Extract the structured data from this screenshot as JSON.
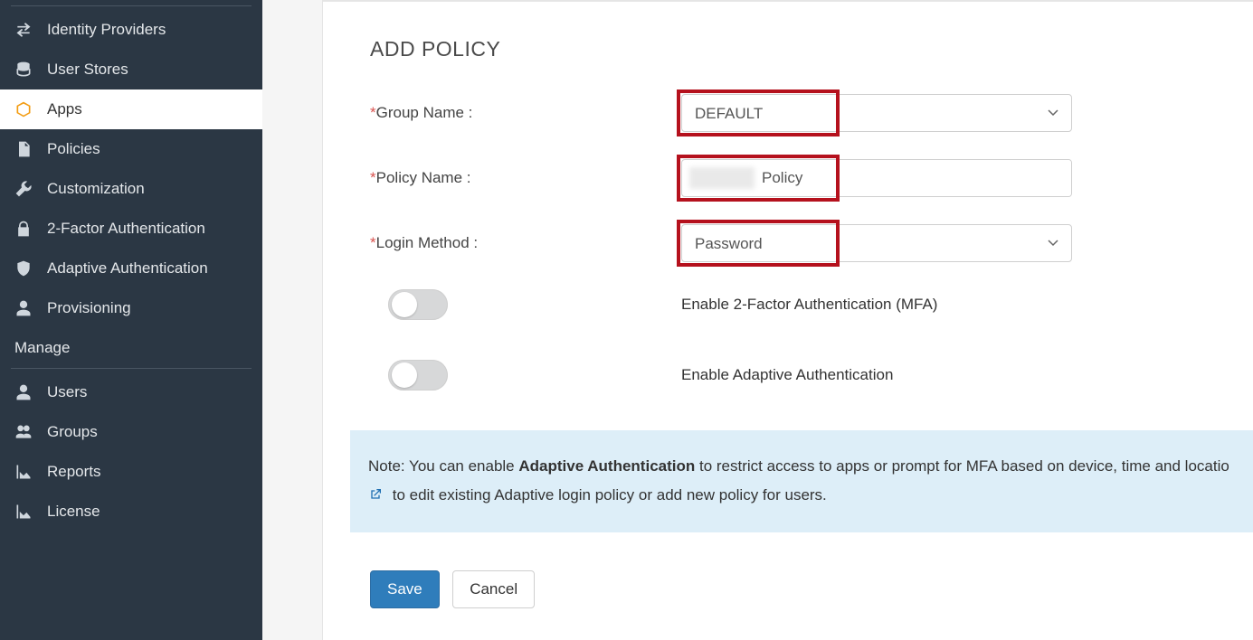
{
  "sidebar": {
    "items": [
      {
        "label": "Identity Providers",
        "icon": "swap-icon"
      },
      {
        "label": "User Stores",
        "icon": "database-icon"
      },
      {
        "label": "Apps",
        "icon": "cube-icon",
        "active": true
      },
      {
        "label": "Policies",
        "icon": "document-icon"
      },
      {
        "label": "Customization",
        "icon": "wrench-icon"
      },
      {
        "label": "2-Factor Authentication",
        "icon": "lock-icon"
      },
      {
        "label": "Adaptive Authentication",
        "icon": "shield-icon"
      },
      {
        "label": "Provisioning",
        "icon": "user-icon"
      }
    ],
    "manage_label": "Manage",
    "manage_items": [
      {
        "label": "Users",
        "icon": "user-icon"
      },
      {
        "label": "Groups",
        "icon": "users-icon"
      },
      {
        "label": "Reports",
        "icon": "area-chart-icon"
      },
      {
        "label": "License",
        "icon": "area-chart-icon"
      }
    ]
  },
  "page": {
    "title": "ADD POLICY"
  },
  "form": {
    "group_name_label": "Group Name :",
    "group_name_value": "DEFAULT",
    "policy_name_label": "Policy Name :",
    "policy_name_value": "Policy",
    "login_method_label": "Login Method :",
    "login_method_value": "Password",
    "toggle_mfa_label": "Enable 2-Factor Authentication (MFA)",
    "toggle_adaptive_label": "Enable Adaptive Authentication"
  },
  "note": {
    "prefix": "Note: You can enable ",
    "bold": "Adaptive Authentication",
    "mid": " to restrict access to apps or prompt for MFA based on device, time and locatio",
    "line2": " to edit existing Adaptive login policy or add new policy for users."
  },
  "buttons": {
    "save": "Save",
    "cancel": "Cancel"
  }
}
